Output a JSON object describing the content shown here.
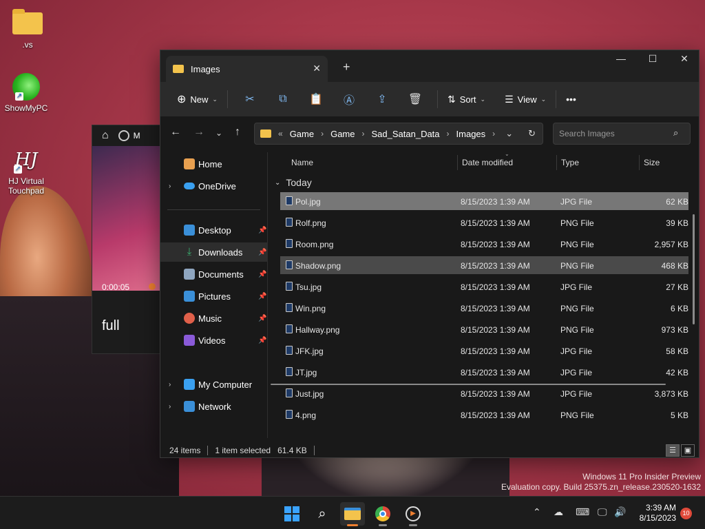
{
  "desktop": {
    "icons": [
      {
        "label": ".vs"
      },
      {
        "label": "ShowMyPC"
      },
      {
        "label": "HJ Virtual Touchpad"
      }
    ]
  },
  "media_player": {
    "home_icon": "home-icon",
    "title_fragment": "M",
    "time": "0:00:05",
    "label": "full"
  },
  "explorer": {
    "tab_title": "Images",
    "new_tab_glyph": "+",
    "toolbar": {
      "new_label": "New",
      "sort_label": "Sort",
      "view_label": "View",
      "more_glyph": "•••"
    },
    "breadcrumb": [
      "Game",
      "Game",
      "Sad_Satan_Data",
      "Images"
    ],
    "search_placeholder": "Search Images",
    "nav": [
      {
        "label": "Home",
        "icon": "home-icon",
        "color": "#e8a050"
      },
      {
        "label": "OneDrive",
        "icon": "cloud-icon",
        "color": "#3aa0f0"
      },
      {
        "label": "Desktop",
        "icon": "desktop-icon",
        "color": "#3a8fd8"
      },
      {
        "label": "Downloads",
        "icon": "download-icon",
        "color": "#3ab070"
      },
      {
        "label": "Documents",
        "icon": "documents-icon",
        "color": "#8fa6c0"
      },
      {
        "label": "Pictures",
        "icon": "pictures-icon",
        "color": "#3a8fd8"
      },
      {
        "label": "Music",
        "icon": "music-icon",
        "color": "#e0604a"
      },
      {
        "label": "Videos",
        "icon": "videos-icon",
        "color": "#8a5ad8"
      },
      {
        "label": "My Computer",
        "icon": "computer-icon",
        "color": "#3aa0f0"
      },
      {
        "label": "Network",
        "icon": "network-icon",
        "color": "#3a8fd8"
      }
    ],
    "columns": {
      "name": "Name",
      "date": "Date modified",
      "type": "Type",
      "size": "Size"
    },
    "group": "Today",
    "files": [
      {
        "name": "Pol.jpg",
        "date": "8/15/2023 1:39 AM",
        "type": "JPG File",
        "size": "62 KB"
      },
      {
        "name": "Rolf.png",
        "date": "8/15/2023 1:39 AM",
        "type": "PNG File",
        "size": "39 KB"
      },
      {
        "name": "Room.png",
        "date": "8/15/2023 1:39 AM",
        "type": "PNG File",
        "size": "2,957 KB"
      },
      {
        "name": "Shadow.png",
        "date": "8/15/2023 1:39 AM",
        "type": "PNG File",
        "size": "468 KB"
      },
      {
        "name": "Tsu.jpg",
        "date": "8/15/2023 1:39 AM",
        "type": "JPG File",
        "size": "27 KB"
      },
      {
        "name": "Win.png",
        "date": "8/15/2023 1:39 AM",
        "type": "PNG File",
        "size": "6 KB"
      },
      {
        "name": "Hallway.png",
        "date": "8/15/2023 1:39 AM",
        "type": "PNG File",
        "size": "973 KB"
      },
      {
        "name": "JFK.jpg",
        "date": "8/15/2023 1:39 AM",
        "type": "JPG File",
        "size": "58 KB"
      },
      {
        "name": "JT.jpg",
        "date": "8/15/2023 1:39 AM",
        "type": "JPG File",
        "size": "42 KB"
      },
      {
        "name": "Just.jpg",
        "date": "8/15/2023 1:39 AM",
        "type": "JPG File",
        "size": "3,873 KB"
      },
      {
        "name": "4.png",
        "date": "8/15/2023 1:39 AM",
        "type": "PNG File",
        "size": "5 KB"
      }
    ],
    "status": {
      "items": "24 items",
      "selected": "1 item selected",
      "selected_size": "61.4 KB"
    }
  },
  "watermark": {
    "line1": "Windows 11 Pro Insider Preview",
    "line2": "Evaluation copy. Build 25375.zn_release.230520-1632"
  },
  "taskbar": {
    "time": "3:39 AM",
    "date": "8/15/2023",
    "notification_count": "10"
  }
}
